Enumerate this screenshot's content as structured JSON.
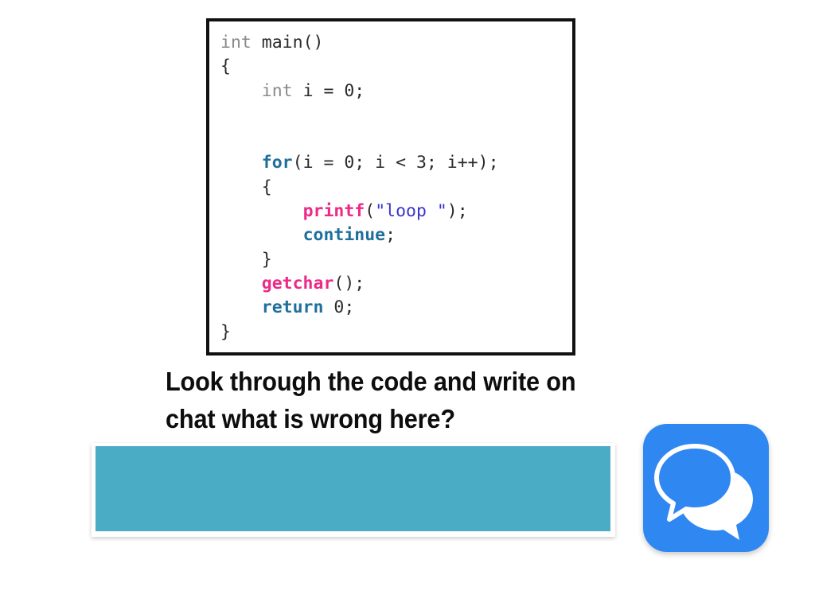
{
  "slide": {
    "background_color": "#ffffff",
    "prompt_lines": [
      "Look through the code and write on",
      "chat what is wrong here?"
    ]
  },
  "code_box": {
    "border_color": "#111111",
    "background": "#ffffff",
    "language": "c",
    "colors": {
      "type_keyword": "#8a8a8a",
      "control_keyword": "#1f6f9c",
      "function": "#ec2a87",
      "string": "#3a34cd",
      "plain": "#2b2b2b"
    },
    "lines": [
      {
        "indent": 0,
        "tokens": [
          {
            "text": "int",
            "kind": "type"
          },
          {
            "text": " main()",
            "kind": "plain"
          }
        ]
      },
      {
        "indent": 0,
        "tokens": [
          {
            "text": "{",
            "kind": "plain"
          }
        ]
      },
      {
        "indent": 1,
        "tokens": [
          {
            "text": "int",
            "kind": "type"
          },
          {
            "text": " i = 0;",
            "kind": "plain"
          }
        ]
      },
      {
        "indent": 0,
        "tokens": []
      },
      {
        "indent": 0,
        "tokens": []
      },
      {
        "indent": 1,
        "tokens": [
          {
            "text": "for",
            "kind": "kw"
          },
          {
            "text": "(i = 0; i < 3; i++);",
            "kind": "plain"
          }
        ]
      },
      {
        "indent": 1,
        "tokens": [
          {
            "text": "{",
            "kind": "plain"
          }
        ]
      },
      {
        "indent": 2,
        "tokens": [
          {
            "text": "printf",
            "kind": "fn"
          },
          {
            "text": "(",
            "kind": "plain"
          },
          {
            "text": "\"loop \"",
            "kind": "str"
          },
          {
            "text": ");",
            "kind": "plain"
          }
        ]
      },
      {
        "indent": 2,
        "tokens": [
          {
            "text": "continue",
            "kind": "kw"
          },
          {
            "text": ";",
            "kind": "plain"
          }
        ]
      },
      {
        "indent": 1,
        "tokens": [
          {
            "text": "}",
            "kind": "plain"
          }
        ]
      },
      {
        "indent": 1,
        "tokens": [
          {
            "text": "getchar",
            "kind": "fn"
          },
          {
            "text": "();",
            "kind": "plain"
          }
        ]
      },
      {
        "indent": 1,
        "tokens": [
          {
            "text": "return",
            "kind": "kw"
          },
          {
            "text": " 0;",
            "kind": "plain"
          }
        ]
      },
      {
        "indent": 0,
        "tokens": [
          {
            "text": "}",
            "kind": "plain"
          }
        ]
      }
    ]
  },
  "answer_box": {
    "fill_color": "#4bacc6",
    "value": "",
    "placeholder": ""
  },
  "chat_icon": {
    "name": "chat-bubbles-icon",
    "background_color": "#2f87f2",
    "glyph_color": "#ffffff"
  }
}
